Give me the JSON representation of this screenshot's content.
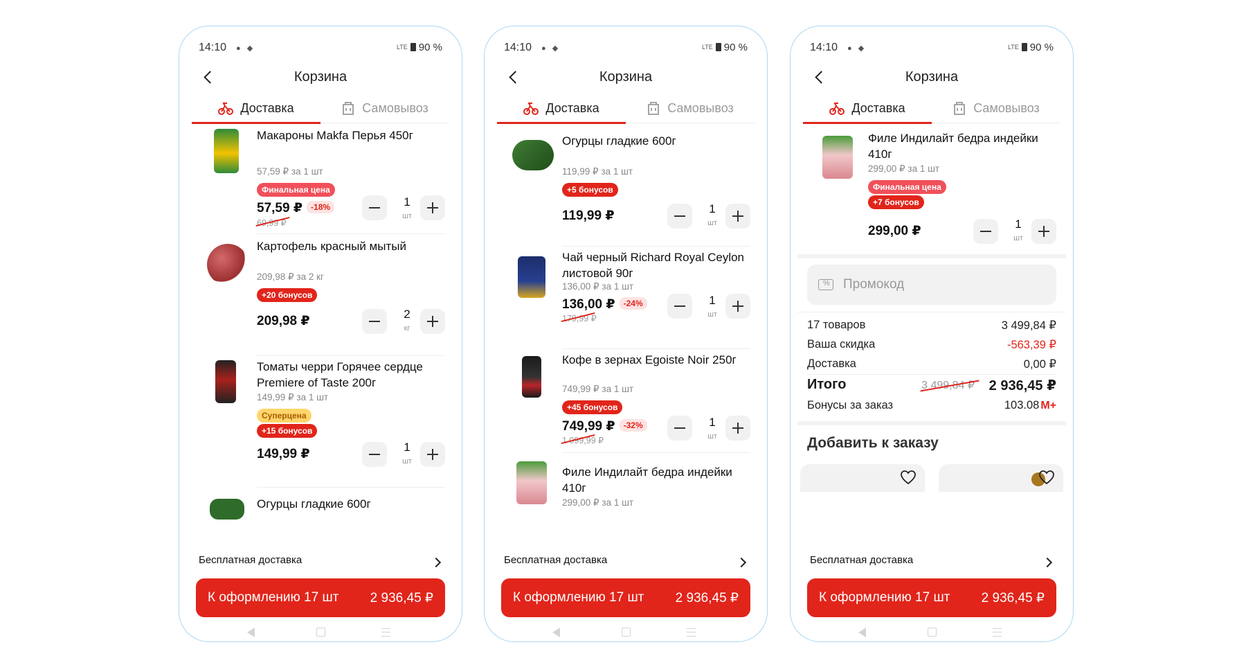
{
  "phones": [
    {
      "status": {
        "time": "14:10",
        "battery": "90 %",
        "network": "LTE"
      },
      "header": {
        "title": "Корзина"
      },
      "tabs": {
        "delivery": "Доставка",
        "pickup": "Самовывоз"
      },
      "items": [
        {
          "name": "Макароны Makfa Перья 450г",
          "unit_price": "57,59 ₽ за 1 шт",
          "badges": [
            "Финальная цена"
          ],
          "price": "57,59 ₽",
          "discount": "-18%",
          "old_price": "69,99 ₽",
          "qty": "1",
          "qty_unit": "шт"
        },
        {
          "name": "Картофель красный мытый",
          "unit_price": "209,98 ₽ за 2 кг",
          "badges": [
            "+20 бонусов"
          ],
          "price": "209,98 ₽",
          "qty": "2",
          "qty_unit": "кг"
        },
        {
          "name": "Томаты черри Горячее сердце Premiere of Taste 200г",
          "unit_price": "149,99 ₽ за 1 шт",
          "badges": [
            "Суперцена",
            "+15 бонусов"
          ],
          "price": "149,99 ₽",
          "qty": "1",
          "qty_unit": "шт"
        },
        {
          "name": "Огурцы гладкие 600г"
        }
      ],
      "free_delivery": "Бесплатная доставка",
      "checkout": {
        "label": "К оформлению 17 шт",
        "amount": "2 936,45 ₽"
      }
    },
    {
      "status": {
        "time": "14:10",
        "battery": "90 %",
        "network": "LTE"
      },
      "header": {
        "title": "Корзина"
      },
      "tabs": {
        "delivery": "Доставка",
        "pickup": "Самовывоз"
      },
      "items": [
        {
          "name": "Огурцы гладкие 600г",
          "unit_price": "119,99 ₽ за 1 шт",
          "badges": [
            "+5 бонусов"
          ],
          "price": "119,99 ₽",
          "qty": "1",
          "qty_unit": "шт"
        },
        {
          "name": "Чай черный Richard Royal Ceylon листовой 90г",
          "unit_price": "136,00 ₽ за 1 шт",
          "price": "136,00 ₽",
          "discount": "-24%",
          "old_price": "179,99 ₽",
          "qty": "1",
          "qty_unit": "шт"
        },
        {
          "name": "Кофе в зернах Egoiste Noir 250г",
          "unit_price": "749,99 ₽ за 1 шт",
          "badges": [
            "+45 бонусов"
          ],
          "price": "749,99 ₽",
          "discount": "-32%",
          "old_price": "1 099,99 ₽",
          "qty": "1",
          "qty_unit": "шт"
        },
        {
          "name": "Филе Индилайт бедра индейки 410г",
          "unit_price": "299,00 ₽ за 1 шт"
        }
      ],
      "free_delivery": "Бесплатная доставка",
      "checkout": {
        "label": "К оформлению 17 шт",
        "amount": "2 936,45 ₽"
      }
    },
    {
      "status": {
        "time": "14:10",
        "battery": "90 %",
        "network": "LTE"
      },
      "header": {
        "title": "Корзина"
      },
      "tabs": {
        "delivery": "Доставка",
        "pickup": "Самовывоз"
      },
      "items": [
        {
          "name": "Филе Индилайт бедра индейки 410г",
          "unit_price": "299,00 ₽ за 1 шт",
          "badges": [
            "Финальная цена",
            "+7 бонусов"
          ],
          "price": "299,00 ₽",
          "qty": "1",
          "qty_unit": "шт"
        }
      ],
      "promo_placeholder": "Промокод",
      "summary": {
        "items_label": "17 товаров",
        "items_value": "3 499,84 ₽",
        "discount_label": "Ваша скидка",
        "discount_value": "-563,39 ₽",
        "delivery_label": "Доставка",
        "delivery_value": "0,00 ₽",
        "total_label": "Итого",
        "total_old": "3 499,84 ₽",
        "total_value": "2 936,45 ₽",
        "bonus_label": "Бонусы за заказ",
        "bonus_value": "103.08",
        "bonus_mark": "М+"
      },
      "add_to_order": "Добавить к заказу",
      "free_delivery": "Бесплатная доставка",
      "checkout": {
        "label": "К оформлению 17 шт",
        "amount": "2 936,45 ₽"
      }
    }
  ],
  "colors": {
    "accent": "#e1251b",
    "bonus_badge": "#e1251b",
    "final_badge": "#f0505a",
    "super_badge": "#ffd56a",
    "frame": "#a9d8f2"
  },
  "icons": [
    "back-icon",
    "bike-icon",
    "bag-icon",
    "chevron-right-icon",
    "minus-icon",
    "plus-icon",
    "promo-icon",
    "heart-icon",
    "nav-back-icon",
    "nav-home-icon",
    "nav-recent-icon"
  ]
}
